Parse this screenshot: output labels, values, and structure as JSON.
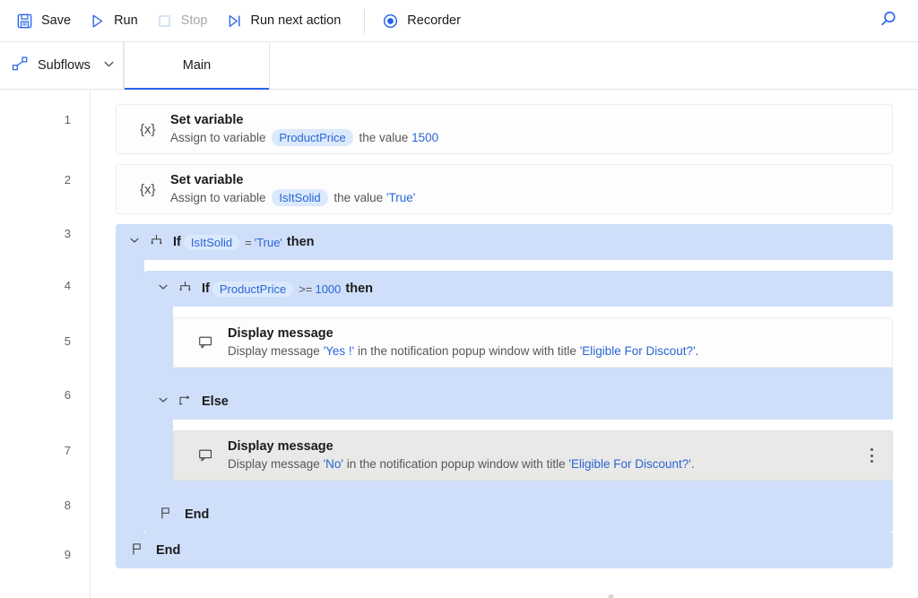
{
  "toolbar": {
    "save_label": "Save",
    "run_label": "Run",
    "stop_label": "Stop",
    "run_next_label": "Run next action",
    "recorder_label": "Recorder",
    "search_icon": "search-icon",
    "accent_color": "#2563eb",
    "disabled_color": "#a6a6a6"
  },
  "tabbar": {
    "subflows_label": "Subflows",
    "subflows_icon": "subflow-icon",
    "chevron_icon": "chevron-down-icon",
    "tabs": [
      {
        "label": "Main",
        "active": true
      }
    ]
  },
  "gutter": {
    "line_numbers": [
      "1",
      "2",
      "3",
      "4",
      "5",
      "6",
      "7",
      "8",
      "9"
    ]
  },
  "flow": {
    "steps": [
      {
        "line": "1",
        "type": "action",
        "icon": "set-variable-icon",
        "icon_glyph": "{x}",
        "title": "Set variable",
        "desc_pre": "Assign to variable",
        "variable": "ProductPrice",
        "desc_mid": "the value",
        "value": "1500"
      },
      {
        "line": "2",
        "type": "action",
        "icon": "set-variable-icon",
        "icon_glyph": "{x}",
        "title": "Set variable",
        "desc_pre": "Assign to variable",
        "variable": "IsItSolid",
        "desc_mid": "the value",
        "value": "'True'"
      },
      {
        "line": "3",
        "type": "if",
        "icon": "if-branch-icon",
        "keyword": "If",
        "variable": "IsItSolid",
        "operator": "=",
        "operand": "'True'",
        "then_label": "then"
      },
      {
        "line": "4",
        "type": "if",
        "icon": "if-branch-icon",
        "keyword": "If",
        "variable": "ProductPrice",
        "operator": ">=",
        "operand": "1000",
        "then_label": "then"
      },
      {
        "line": "5",
        "type": "action",
        "icon": "display-message-icon",
        "title": "Display message",
        "desc_pre": "Display message",
        "message": "'Yes !'",
        "desc_mid": "in the notification popup window with title",
        "window_title": "'Eligible For Discout?'",
        "desc_end": ".",
        "selected": false
      },
      {
        "line": "6",
        "type": "else",
        "icon": "else-icon",
        "label": "Else"
      },
      {
        "line": "7",
        "type": "action",
        "icon": "display-message-icon",
        "title": "Display message",
        "desc_pre": "Display message",
        "message": "'No'",
        "desc_mid": "in the notification popup window with title",
        "window_title": "'Eligible For Discount?'",
        "desc_end": ".",
        "selected": true,
        "kebab_icon": "more-options-icon"
      },
      {
        "line": "8",
        "type": "end",
        "icon": "end-flag-icon",
        "label": "End"
      },
      {
        "line": "9",
        "type": "end",
        "icon": "end-flag-icon",
        "label": "End"
      }
    ]
  },
  "colors": {
    "block_bg": "#cfdffa",
    "pill_bg": "#dbe9fd",
    "pill_text": "#2a65d6",
    "selected_row_bg": "#e9e9e7"
  }
}
